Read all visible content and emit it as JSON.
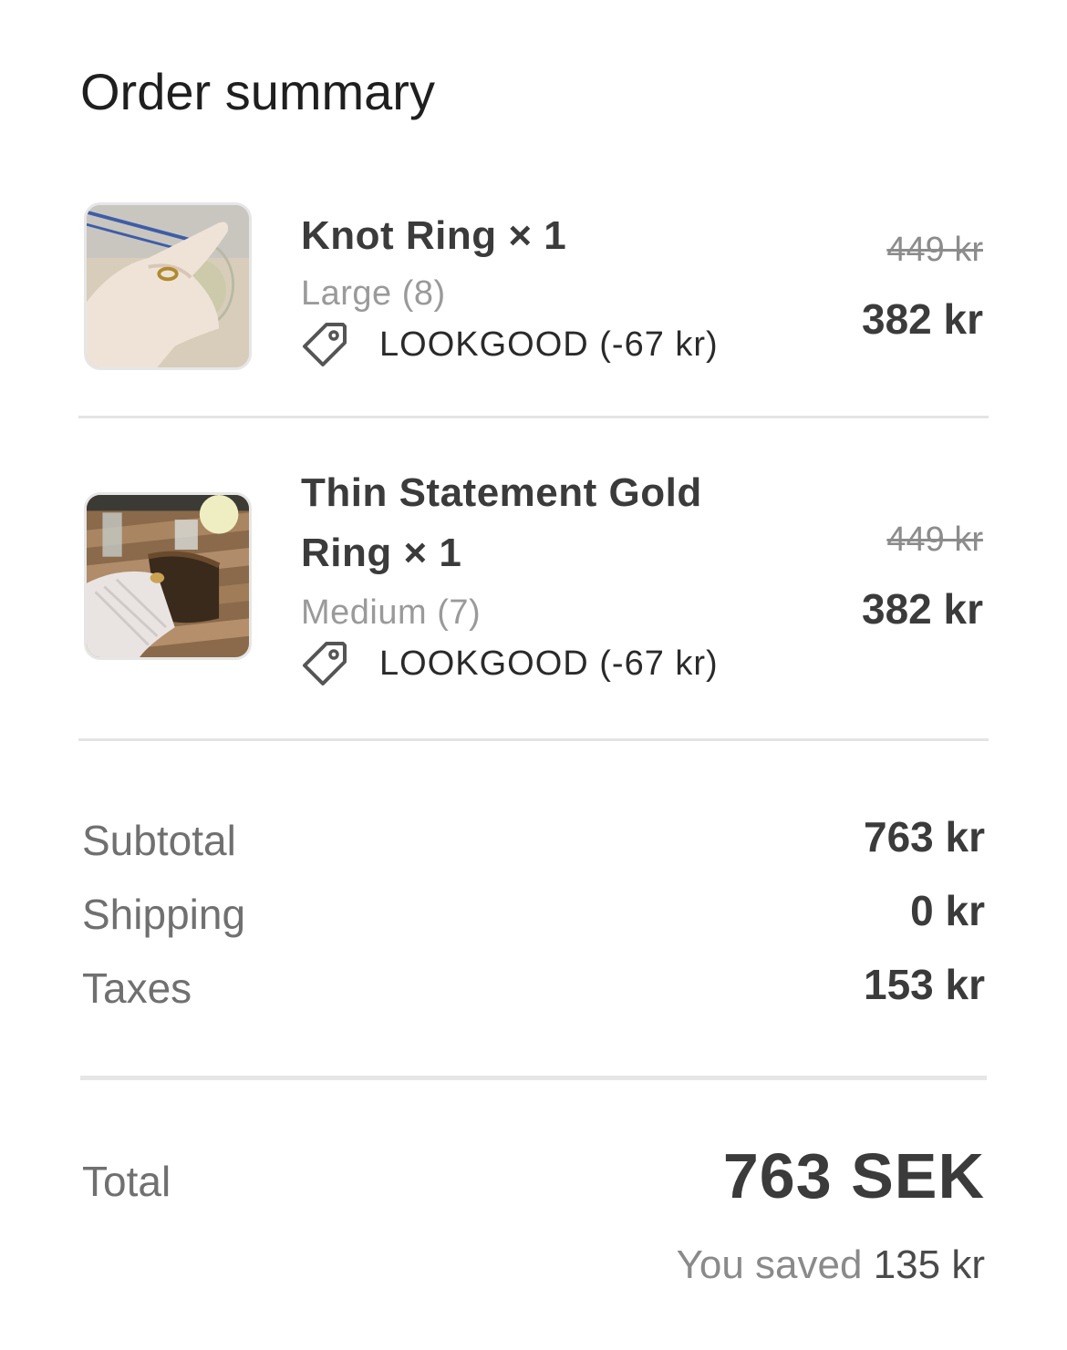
{
  "title": "Order summary",
  "items": [
    {
      "name": "Knot Ring × 1",
      "variant": "Large (8)",
      "discount": "LOOKGOOD (-67 kr)",
      "original_price": "449 kr",
      "price": "382 kr"
    },
    {
      "name": "Thin Statement Gold Ring × 1",
      "variant": "Medium (7)",
      "discount": "LOOKGOOD (-67 kr)",
      "original_price": "449 kr",
      "price": "382 kr"
    }
  ],
  "summary": {
    "subtotal_label": "Subtotal",
    "subtotal_value": "763 kr",
    "shipping_label": "Shipping",
    "shipping_value": "0 kr",
    "taxes_label": "Taxes",
    "taxes_value": "153 kr"
  },
  "total": {
    "label": "Total",
    "value": "763 SEK",
    "saved_prefix": "You saved",
    "saved_amount": "135 kr"
  },
  "icons": {
    "discount": "tag-icon"
  }
}
